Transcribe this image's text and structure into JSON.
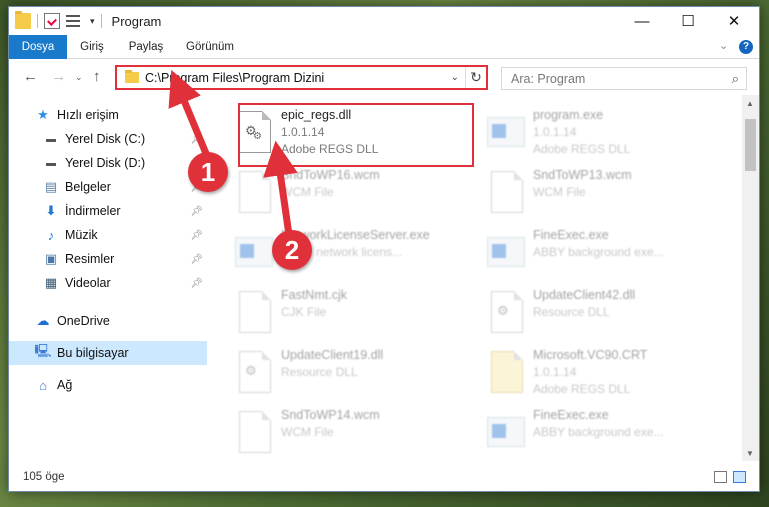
{
  "window": {
    "title": "Program",
    "quick_access": [
      "folder-icon",
      "properties-icon",
      "view-icon"
    ]
  },
  "ribbon": {
    "tabs": [
      "Dosya",
      "Giriş",
      "Paylaş",
      "Görünüm"
    ],
    "active": "Dosya"
  },
  "navbar": {
    "address": "C:\\Program Files\\Program Dizini",
    "search_placeholder": "Ara: Program"
  },
  "sidebar": {
    "items": [
      {
        "label": "Hızlı erişim",
        "icon": "star-icon",
        "pinned": false
      },
      {
        "label": "Yerel Disk (C:)",
        "icon": "drive-icon",
        "pinned": true
      },
      {
        "label": "Yerel Disk (D:)",
        "icon": "drive-icon",
        "pinned": true
      },
      {
        "label": "Belgeler",
        "icon": "documents-icon",
        "pinned": true
      },
      {
        "label": "İndirmeler",
        "icon": "download-icon",
        "pinned": true
      },
      {
        "label": "Müzik",
        "icon": "music-icon",
        "pinned": true
      },
      {
        "label": "Resimler",
        "icon": "pictures-icon",
        "pinned": true
      },
      {
        "label": "Videolar",
        "icon": "videos-icon",
        "pinned": true
      },
      {
        "label": "OneDrive",
        "icon": "cloud-icon",
        "pinned": false
      },
      {
        "label": "Bu bilgisayar",
        "icon": "computer-icon",
        "pinned": false,
        "selected": true
      },
      {
        "label": "Ağ",
        "icon": "network-icon",
        "pinned": false
      }
    ]
  },
  "files": [
    {
      "name": "epic_regs.dll",
      "line2": "1.0.1.14",
      "line3": "Adobe REGS DLL",
      "kind": "dll",
      "highlighted": true
    },
    {
      "name": "program.exe",
      "line2": "1.0.1.14",
      "line3": "Adobe REGS DLL",
      "kind": "exe"
    },
    {
      "name": "SndToWP16.wcm",
      "line2": "WCM File",
      "line3": "",
      "kind": "doc"
    },
    {
      "name": "SndToWP13.wcm",
      "line2": "WCM File",
      "line3": "",
      "kind": "doc"
    },
    {
      "name": "NetworkLicenseServer.exe",
      "line2": "ABBY network licens...",
      "line3": "",
      "kind": "exe"
    },
    {
      "name": "FineExec.exe",
      "line2": "ABBY background exe...",
      "line3": "",
      "kind": "exe"
    },
    {
      "name": "FastNmt.cjk",
      "line2": "CJK File",
      "line3": "",
      "kind": "doc"
    },
    {
      "name": "UpdateClient42.dll",
      "line2": "Resource DLL",
      "line3": "",
      "kind": "dll"
    },
    {
      "name": "UpdateClient19.dll",
      "line2": "Resource DLL",
      "line3": "",
      "kind": "dll"
    },
    {
      "name": "Microsoft.VC90.CRT",
      "line2": "1.0.1.14",
      "line3": "Adobe REGS DLL",
      "kind": "folder"
    },
    {
      "name": "SndToWP14.wcm",
      "line2": "WCM File",
      "line3": "",
      "kind": "doc"
    },
    {
      "name": "FineExec.exe",
      "line2": "ABBY background exe...",
      "line3": "",
      "kind": "exe"
    }
  ],
  "status": {
    "count": "105 öge"
  },
  "annotations": {
    "badge1": "1",
    "badge2": "2"
  },
  "colors": {
    "accent": "#1979ca",
    "highlight": "#e0313b",
    "selection": "#cce8ff"
  }
}
